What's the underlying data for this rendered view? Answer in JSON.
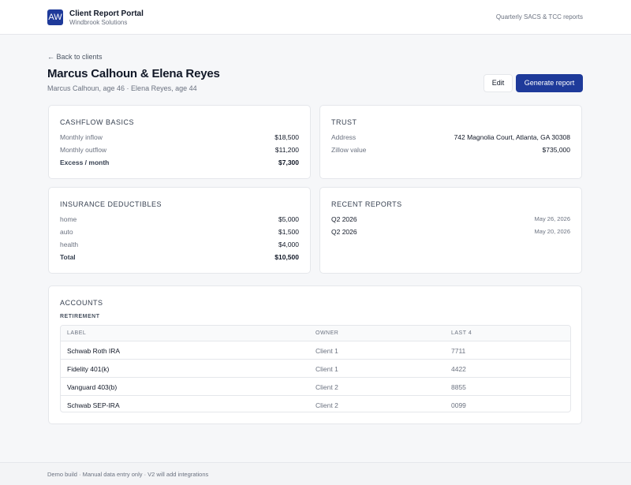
{
  "header": {
    "logo_text": "AW",
    "app_title": "Client Report Portal",
    "company": "Windbrook Solutions",
    "right_text": "Quarterly SACS & TCC reports"
  },
  "nav": {
    "back_label": "← Back to clients"
  },
  "client": {
    "name": "Marcus Calhoun & Elena Reyes",
    "subtitle": "Marcus Calhoun, age 46 · Elena Reyes, age 44"
  },
  "actions": {
    "edit_label": "Edit",
    "generate_label": "Generate report"
  },
  "cashflow": {
    "title": "CASHFLOW BASICS",
    "rows": [
      {
        "label": "Monthly inflow",
        "value": "$18,500"
      },
      {
        "label": "Monthly outflow",
        "value": "$11,200"
      },
      {
        "label": "Excess / month",
        "value": "$7,300"
      }
    ]
  },
  "trust": {
    "title": "TRUST",
    "rows": [
      {
        "label": "Address",
        "value": "742 Magnolia Court, Atlanta, GA 30308"
      },
      {
        "label": "Zillow value",
        "value": "$735,000"
      }
    ]
  },
  "insurance": {
    "title": "INSURANCE DEDUCTIBLES",
    "rows": [
      {
        "label": "home",
        "value": "$5,000"
      },
      {
        "label": "auto",
        "value": "$1,500"
      },
      {
        "label": "health",
        "value": "$4,000"
      },
      {
        "label": "Total",
        "value": "$10,500"
      }
    ]
  },
  "reports": {
    "title": "RECENT REPORTS",
    "items": [
      {
        "label": "Q2 2026",
        "date": "May 26, 2026"
      },
      {
        "label": "Q2 2026",
        "date": "May 20, 2026"
      }
    ]
  },
  "accounts": {
    "title": "ACCOUNTS",
    "section": "RETIREMENT",
    "columns": [
      "LABEL",
      "OWNER",
      "LAST 4"
    ],
    "rows": [
      {
        "label": "Schwab Roth IRA",
        "owner": "Client 1",
        "last4": "7711"
      },
      {
        "label": "Fidelity 401(k)",
        "owner": "Client 1",
        "last4": "4422"
      },
      {
        "label": "Vanguard 403(b)",
        "owner": "Client 2",
        "last4": "8855"
      },
      {
        "label": "Schwab SEP-IRA",
        "owner": "Client 2",
        "last4": "0099"
      }
    ]
  },
  "footer": {
    "text": "Demo build · Manual data entry only · V2 will add integrations"
  },
  "colors": {
    "primary": "#1e3a9a",
    "background": "#f6f7f9",
    "border": "#e5e7eb"
  }
}
